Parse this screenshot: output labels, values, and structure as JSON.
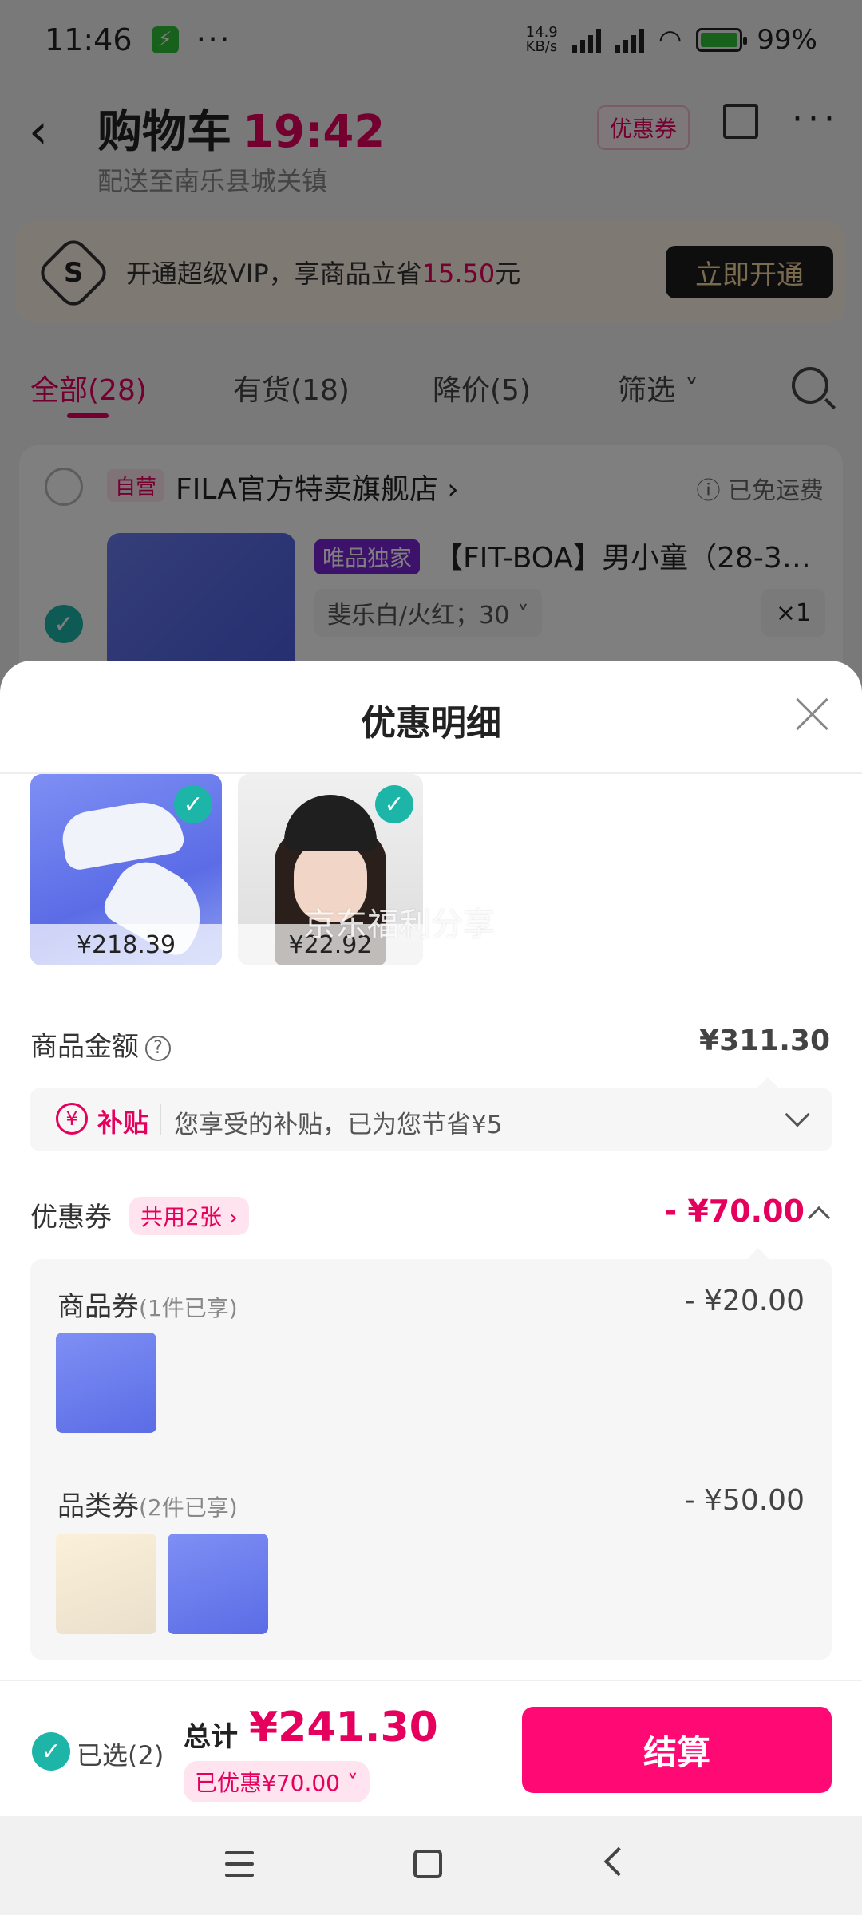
{
  "status_bar": {
    "time": "11:46",
    "dots": "···",
    "net_speed_top": "14.9",
    "net_speed_unit": "KB/s",
    "battery_percent": "99%"
  },
  "header": {
    "title": "购物车",
    "timer": "19:42",
    "coupon_chip": "优惠券",
    "delivery": "配送至南乐县城关镇"
  },
  "vip_banner": {
    "icon_letter": "S",
    "text_prefix": "开通超级VIP，享商品立省",
    "amount": "15.50",
    "text_suffix": "元",
    "button": "立即开通"
  },
  "filter_tabs": {
    "all": "全部(28)",
    "in_stock": "有货(18)",
    "price_drop": "降价(5)",
    "filter": "筛选"
  },
  "store": {
    "self_tag": "自营",
    "name": "FILA官方特卖旗舰店",
    "freeship": "已免运费",
    "exclusive_tag": "唯品独家",
    "product_name": "【FIT-BOA】男小童（28-3…",
    "spec": "斐乐白/火红；30",
    "qty": "×1"
  },
  "sheet": {
    "title": "优惠明细",
    "items": [
      {
        "price": "¥218.39"
      },
      {
        "price": "¥22.92"
      }
    ],
    "watermark": "京东福利分享",
    "goods_amount_label": "商品金额",
    "goods_amount_value": "¥311.30",
    "subsidy_tag": "补贴",
    "subsidy_text": "您享受的补贴，已为您节省¥5",
    "coupon_label": "优惠券",
    "coupon_count": "共用2张",
    "coupon_total": "- ¥70.00",
    "product_coupon": {
      "title": "商品券",
      "sub": "(1件已享)",
      "amount": "- ¥20.00"
    },
    "category_coupon": {
      "title": "品类券",
      "sub": "(2件已享)",
      "amount": "- ¥50.00"
    }
  },
  "footer": {
    "selected": "已选(2)",
    "total_label": "总计",
    "total_value": "¥241.30",
    "saved": "已优惠¥70.00",
    "checkout": "结算"
  },
  "colors": {
    "accent": "#e6005e",
    "checkout": "#ff0a75",
    "check": "#1cb5a8"
  }
}
